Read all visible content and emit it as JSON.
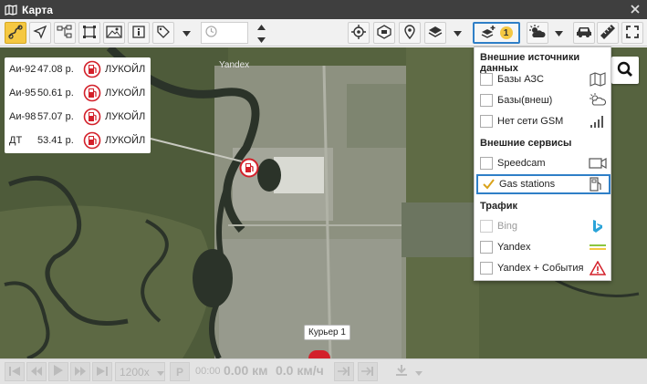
{
  "window": {
    "title": "Карта",
    "icon": "map-icon",
    "close_icon": "close-icon"
  },
  "toolbar": {
    "buttons": [
      {
        "name": "route-tool-button",
        "icon": "route-icon",
        "active": true
      },
      {
        "name": "navigation-button",
        "icon": "navigation-arrow-icon"
      },
      {
        "name": "tree-button",
        "icon": "tree-icon"
      },
      {
        "name": "select-area-button",
        "icon": "select-area-icon"
      },
      {
        "name": "image-button",
        "icon": "image-icon"
      },
      {
        "name": "info-button",
        "icon": "info-icon"
      },
      {
        "name": "tag-button",
        "icon": "tag-icon"
      },
      {
        "name": "locate-button",
        "icon": "crosshair-icon"
      },
      {
        "name": "vehicle-button",
        "icon": "vehicle-icon"
      },
      {
        "name": "pin-button",
        "icon": "pin-icon"
      },
      {
        "name": "layers-button",
        "icon": "layers-icon"
      },
      {
        "name": "external-layers-button",
        "icon": "layers-add-icon",
        "badge": "1"
      },
      {
        "name": "weather-button",
        "icon": "weather-icon"
      },
      {
        "name": "car-button",
        "icon": "car-icon"
      },
      {
        "name": "ruler-button",
        "icon": "ruler-icon"
      },
      {
        "name": "fullscreen-button",
        "icon": "fullscreen-icon"
      }
    ],
    "time_value": "",
    "time_icon": "clock-icon"
  },
  "fuel_prices": [
    {
      "type": "Аи-92",
      "price": "47.08 р.",
      "brand": "ЛУКОЙЛ"
    },
    {
      "type": "Аи-95",
      "price": "50.61 р.",
      "brand": "ЛУКОЙЛ"
    },
    {
      "type": "Аи-98",
      "price": "57.07 р.",
      "brand": "ЛУКОЙЛ"
    },
    {
      "type": "ДТ",
      "price": "53.41 р.",
      "brand": "ЛУКОЙЛ"
    }
  ],
  "map": {
    "watermark": "Yandex",
    "courier_label": "Курьер 1"
  },
  "layers_panel": {
    "sections": [
      {
        "title": "Внешние источники данных",
        "items": [
          {
            "label": "Базы АЗС",
            "checked": false,
            "icon": "map-icon"
          },
          {
            "label": "Базы(внеш)",
            "checked": false,
            "icon": "weather-icon"
          },
          {
            "label": "Нет сети GSM",
            "checked": false,
            "icon": "signal-icon"
          }
        ]
      },
      {
        "title": "Внешние сервисы",
        "items": [
          {
            "label": "Speedcam",
            "checked": false,
            "icon": "camera-icon"
          },
          {
            "label": "Gas stations",
            "checked": true,
            "icon": "fuel-pump-icon"
          }
        ]
      },
      {
        "title": "Трафик",
        "items": [
          {
            "label": "Bing",
            "checked": false,
            "disabled": true,
            "icon": "bing-icon"
          },
          {
            "label": "Yandex",
            "checked": false,
            "icon": "traffic-lines-icon"
          },
          {
            "label": "Yandex + События",
            "checked": false,
            "icon": "warning-icon"
          }
        ]
      }
    ]
  },
  "player": {
    "speed_factor": "1200x",
    "p_label": "P",
    "time": "00:00",
    "distance": "0.00 км",
    "speed": "0.0 км/ч"
  },
  "colors": {
    "accent": "#f5c842",
    "selection": "#2f7fc7",
    "titlebar": "#3f3f3f",
    "fuel_brand_red": "#d3202a"
  }
}
